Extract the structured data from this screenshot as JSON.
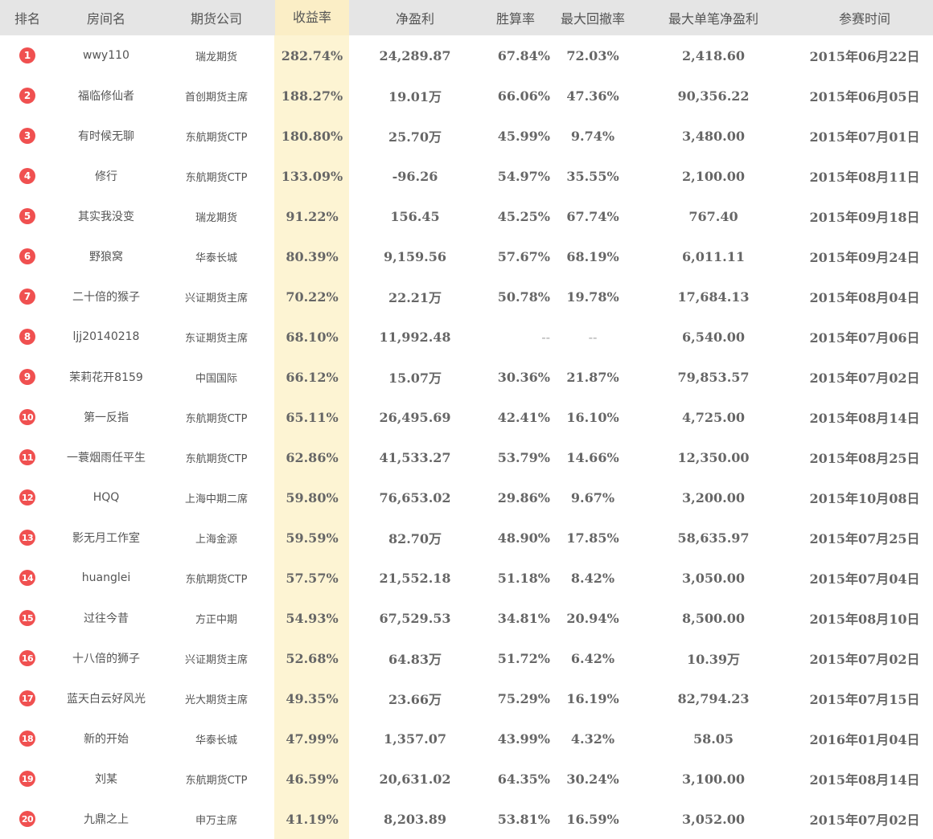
{
  "headers": [
    "排名",
    "房间名",
    "期货公司",
    "收益率",
    "净盈利",
    "胜算率",
    "最大回撤率",
    "最大单笔净盈利",
    "参赛时间"
  ],
  "colors": {
    "rank_badge": "#f05050",
    "highlight_column": "#fdf4d3",
    "header_bg": "#e5e5e5"
  },
  "rows": [
    {
      "rank": "1",
      "room": "wwy110",
      "company": "瑞龙期货",
      "rate": "282.74%",
      "net": "24,289.87",
      "win": "67.84%",
      "drawdown": "72.03%",
      "max_single": "2,418.60",
      "date": "2015年06月22日"
    },
    {
      "rank": "2",
      "room": "福临修仙者",
      "company": "首创期货主席",
      "rate": "188.27%",
      "net": "19.01万",
      "win": "66.06%",
      "drawdown": "47.36%",
      "max_single": "90,356.22",
      "date": "2015年06月05日"
    },
    {
      "rank": "3",
      "room": "有时候无聊",
      "company": "东航期货CTP",
      "rate": "180.80%",
      "net": "25.70万",
      "win": "45.99%",
      "drawdown": "9.74%",
      "max_single": "3,480.00",
      "date": "2015年07月01日"
    },
    {
      "rank": "4",
      "room": "修行",
      "company": "东航期货CTP",
      "rate": "133.09%",
      "net": "-96.26",
      "win": "54.97%",
      "drawdown": "35.55%",
      "max_single": "2,100.00",
      "date": "2015年08月11日"
    },
    {
      "rank": "5",
      "room": "其实我没变",
      "company": "瑞龙期货",
      "rate": "91.22%",
      "net": "156.45",
      "win": "45.25%",
      "drawdown": "67.74%",
      "max_single": "767.40",
      "date": "2015年09月18日"
    },
    {
      "rank": "6",
      "room": "野狼窝",
      "company": "华泰长城",
      "rate": "80.39%",
      "net": "9,159.56",
      "win": "57.67%",
      "drawdown": "68.19%",
      "max_single": "6,011.11",
      "date": "2015年09月24日"
    },
    {
      "rank": "7",
      "room": "二十倍的猴子",
      "company": "兴证期货主席",
      "rate": "70.22%",
      "net": "22.21万",
      "win": "50.78%",
      "drawdown": "19.78%",
      "max_single": "17,684.13",
      "date": "2015年08月04日"
    },
    {
      "rank": "8",
      "room": "ljj20140218",
      "company": "东证期货主席",
      "rate": "68.10%",
      "net": "11,992.48",
      "win": "--",
      "drawdown": "--",
      "max_single": "6,540.00",
      "date": "2015年07月06日"
    },
    {
      "rank": "9",
      "room": "茉莉花开8159",
      "company": "中国国际",
      "rate": "66.12%",
      "net": "15.07万",
      "win": "30.36%",
      "drawdown": "21.87%",
      "max_single": "79,853.57",
      "date": "2015年07月02日"
    },
    {
      "rank": "10",
      "room": "第一反指",
      "company": "东航期货CTP",
      "rate": "65.11%",
      "net": "26,495.69",
      "win": "42.41%",
      "drawdown": "16.10%",
      "max_single": "4,725.00",
      "date": "2015年08月14日"
    },
    {
      "rank": "11",
      "room": "一蓑烟雨任平生",
      "company": "东航期货CTP",
      "rate": "62.86%",
      "net": "41,533.27",
      "win": "53.79%",
      "drawdown": "14.66%",
      "max_single": "12,350.00",
      "date": "2015年08月25日"
    },
    {
      "rank": "12",
      "room": "HQQ",
      "company": "上海中期二席",
      "rate": "59.80%",
      "net": "76,653.02",
      "win": "29.86%",
      "drawdown": "9.67%",
      "max_single": "3,200.00",
      "date": "2015年10月08日"
    },
    {
      "rank": "13",
      "room": "影无月工作室",
      "company": "上海金源",
      "rate": "59.59%",
      "net": "82.70万",
      "win": "48.90%",
      "drawdown": "17.85%",
      "max_single": "58,635.97",
      "date": "2015年07月25日"
    },
    {
      "rank": "14",
      "room": "huanglei",
      "company": "东航期货CTP",
      "rate": "57.57%",
      "net": "21,552.18",
      "win": "51.18%",
      "drawdown": "8.42%",
      "max_single": "3,050.00",
      "date": "2015年07月04日"
    },
    {
      "rank": "15",
      "room": "过往今昔",
      "company": "方正中期",
      "rate": "54.93%",
      "net": "67,529.53",
      "win": "34.81%",
      "drawdown": "20.94%",
      "max_single": "8,500.00",
      "date": "2015年08月10日"
    },
    {
      "rank": "16",
      "room": "十八倍的狮子",
      "company": "兴证期货主席",
      "rate": "52.68%",
      "net": "64.83万",
      "win": "51.72%",
      "drawdown": "6.42%",
      "max_single": "10.39万",
      "date": "2015年07月02日"
    },
    {
      "rank": "17",
      "room": "蓝天白云好风光",
      "company": "光大期货主席",
      "rate": "49.35%",
      "net": "23.66万",
      "win": "75.29%",
      "drawdown": "16.19%",
      "max_single": "82,794.23",
      "date": "2015年07月15日"
    },
    {
      "rank": "18",
      "room": "新的开始",
      "company": "华泰长城",
      "rate": "47.99%",
      "net": "1,357.07",
      "win": "43.99%",
      "drawdown": "4.32%",
      "max_single": "58.05",
      "date": "2016年01月04日"
    },
    {
      "rank": "19",
      "room": "刘某",
      "company": "东航期货CTP",
      "rate": "46.59%",
      "net": "20,631.02",
      "win": "64.35%",
      "drawdown": "30.24%",
      "max_single": "3,100.00",
      "date": "2015年08月14日"
    },
    {
      "rank": "20",
      "room": "九鼎之上",
      "company": "申万主席",
      "rate": "41.19%",
      "net": "8,203.89",
      "win": "53.81%",
      "drawdown": "16.59%",
      "max_single": "3,052.00",
      "date": "2015年07月02日"
    }
  ]
}
